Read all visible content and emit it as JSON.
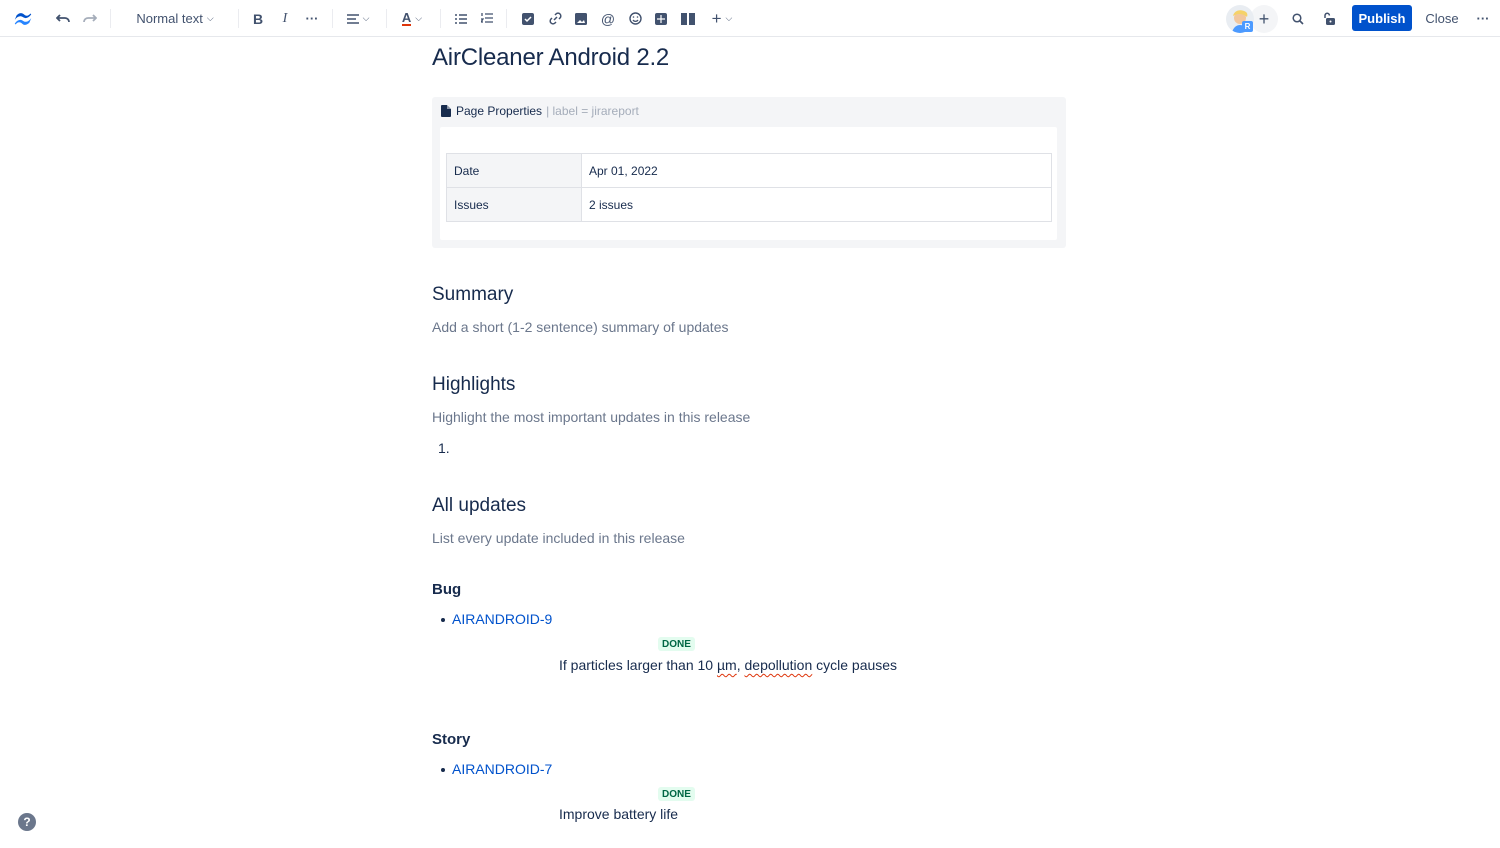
{
  "toolbar": {
    "text_style": "Normal text",
    "publish_label": "Publish",
    "close_label": "Close",
    "avatar_badge": "R",
    "icons": [
      "confluence-logo-icon",
      "undo-icon",
      "redo-icon",
      "bold-icon",
      "italic-icon",
      "more-formatting-icon",
      "align-icon",
      "text-color-icon",
      "bullet-list-icon",
      "numbered-list-icon",
      "action-item-icon",
      "link-icon",
      "image-icon",
      "mention-icon",
      "emoji-icon",
      "table-icon",
      "layouts-icon",
      "insert-icon",
      "search-icon",
      "restrictions-icon",
      "more-icon"
    ]
  },
  "page": {
    "title": "AirCleaner Android 2.2",
    "page_properties": {
      "name": "Page Properties",
      "param": "| label = jirareport",
      "rows": [
        {
          "key": "Date",
          "value": "Apr 01, 2022"
        },
        {
          "key": "Issues",
          "value": "2 issues"
        }
      ]
    },
    "sections": {
      "summary": {
        "heading": "Summary",
        "placeholder": "Add a short (1-2 sentence) summary of updates"
      },
      "highlights": {
        "heading": "Highlights",
        "placeholder": "Highlight the most important updates in this release",
        "list_marker": "1."
      },
      "all_updates": {
        "heading": "All updates",
        "placeholder": "List every update included in this release"
      }
    },
    "groups": [
      {
        "heading": "Bug",
        "issue_key": "AIRANDROID-9",
        "status": "DONE",
        "summary_a": "If particles larger than 10 ",
        "summary_b": "µm",
        "summary_c": ", ",
        "summary_d": "depollution",
        "summary_e": " cycle pauses"
      },
      {
        "heading": "Story",
        "issue_key": "AIRANDROID-7",
        "status": "DONE",
        "summary": "Improve battery life"
      }
    ]
  },
  "help": {
    "label": "?"
  }
}
